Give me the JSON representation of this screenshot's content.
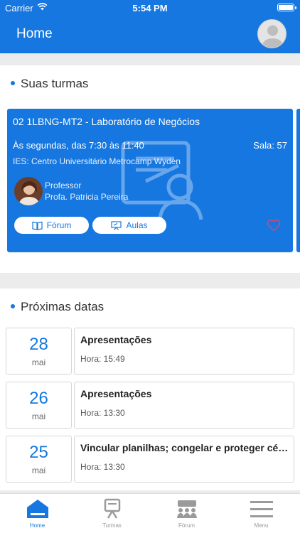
{
  "status_bar": {
    "carrier": "Carrier",
    "time": "5:54 PM"
  },
  "header": {
    "title": "Home"
  },
  "classes": {
    "heading": "Suas turmas",
    "card": {
      "course": "02 1LBNG-MT2 - Laboratório de Negócios",
      "schedule": "Às segundas, das 7:30 às 11:40",
      "room": "Sala: 57",
      "ies": "IES: Centro Universitário Metrocamp Wyden",
      "professor_role": "Professor",
      "professor_name": "Profa. Patricia Pereira",
      "forum_button": "Fórum",
      "lessons_button": "Aulas"
    }
  },
  "upcoming": {
    "heading": "Próximas datas",
    "items": [
      {
        "day": "28",
        "month": "mai",
        "title": "Apresentações",
        "time_label": "Hora: 15:49"
      },
      {
        "day": "26",
        "month": "mai",
        "title": "Apresentações",
        "time_label": "Hora: 13:30"
      },
      {
        "day": "25",
        "month": "mai",
        "title": "Vincular planilhas; congelar e proteger células",
        "time_label": "Hora: 13:30"
      }
    ]
  },
  "tabs": [
    {
      "label": "Home",
      "icon": "home-icon",
      "active": true
    },
    {
      "label": "Turmas",
      "icon": "presentation-icon",
      "active": false
    },
    {
      "label": "Fórum",
      "icon": "group-icon",
      "active": false
    },
    {
      "label": "Menu",
      "icon": "menu-icon",
      "active": false
    }
  ],
  "colors": {
    "primary": "#1677e0",
    "heart": "#e0466a"
  }
}
